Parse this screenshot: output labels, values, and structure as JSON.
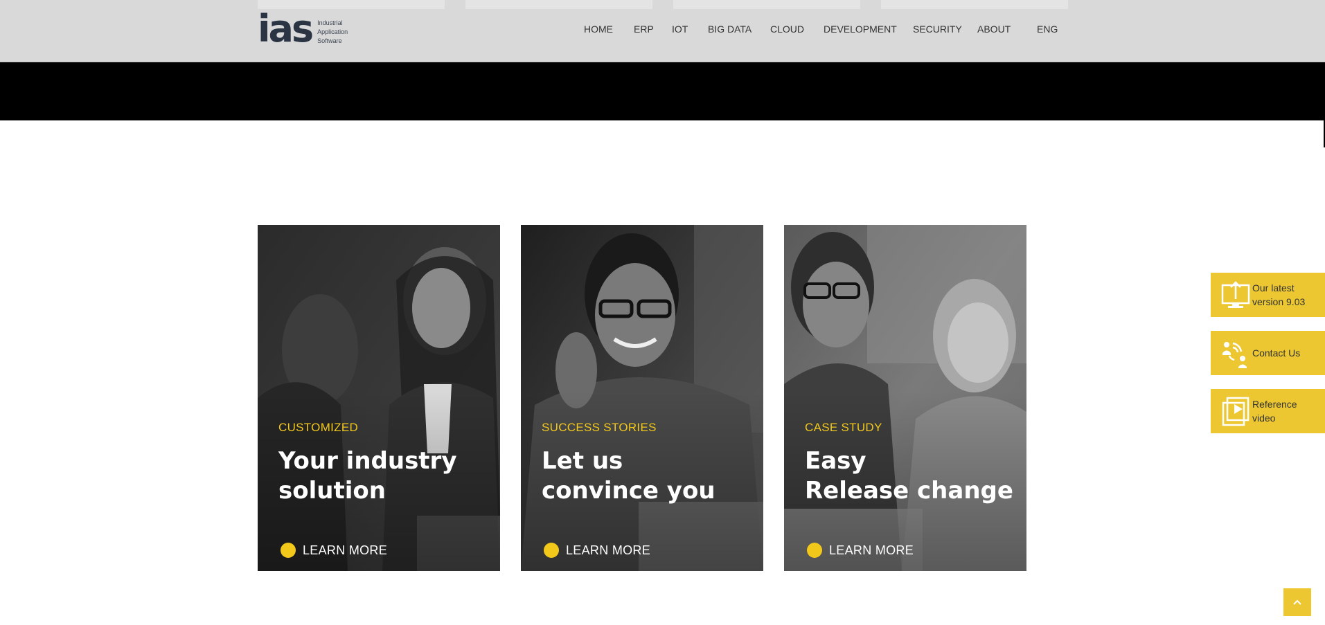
{
  "header": {
    "logo": {
      "mark": "ias",
      "line1": "Industrial",
      "line2": "Application",
      "line3": "Software"
    },
    "nav": [
      {
        "label": "HOME"
      },
      {
        "label": "ERP"
      },
      {
        "label": "IOT"
      },
      {
        "label": "BIG DATA"
      },
      {
        "label": "CLOUD"
      },
      {
        "label": "DEVELOPMENT"
      },
      {
        "label": "SECURITY"
      },
      {
        "label": "ABOUT"
      },
      {
        "label": "ENG"
      }
    ]
  },
  "cards": [
    {
      "eyebrow": "CUSTOMIZED",
      "title": "Your industry\nsolution",
      "cta": "LEARN MORE"
    },
    {
      "eyebrow": "SUCCESS STORIES",
      "title": "Let us\nconvince you",
      "cta": "LEARN MORE"
    },
    {
      "eyebrow": "CASE STUDY",
      "title": "Easy\nRelease change",
      "cta": "LEARN MORE"
    }
  ],
  "side_tabs": [
    {
      "label": "Our latest\nversion 9.03",
      "icon": "monitor-upload-icon"
    },
    {
      "label": "Contact Us",
      "icon": "contact-signal-icon"
    },
    {
      "label": "Reference\nvideo",
      "icon": "video-play-icon"
    }
  ],
  "colors": {
    "accent": "#f2c81b",
    "side_tab": "#ecc732",
    "header_bg": "#d9d9d9",
    "logo": "#2b3443"
  }
}
